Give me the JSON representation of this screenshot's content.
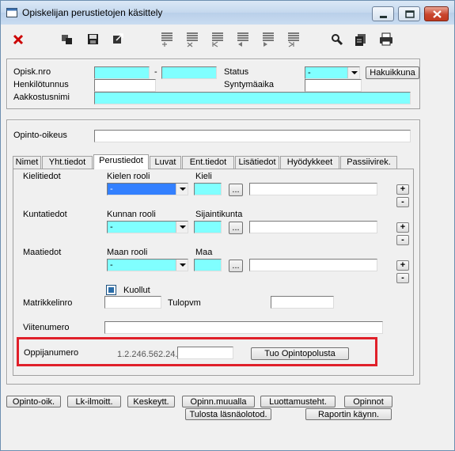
{
  "window": {
    "title": "Opiskelijan perustietojen käsittely"
  },
  "toolbar": {
    "icons": [
      "close-red-icon",
      "copy-icon",
      "save-icon",
      "export-icon",
      "insert-row-icon",
      "delete-row-icon",
      "first-record-icon",
      "previous-record-icon",
      "next-record-icon",
      "last-record-icon",
      "search-icon",
      "clipboard-icon",
      "print-icon"
    ]
  },
  "header": {
    "opisk_nro_label": "Opisk.nro",
    "dash": "-",
    "status_label": "Status",
    "status_value": "-",
    "hakuikkuna_button": "Hakuikkuna",
    "henkilotunnus_label": "Henkilötunnus",
    "syntymaaika_label": "Syntymäaika",
    "aakkostusnimi_label": "Aakkostusnimi"
  },
  "opinto_oikeus": {
    "label": "Opinto-oikeus"
  },
  "tabs": [
    {
      "label": "Nimet"
    },
    {
      "label": "Yht.tiedot"
    },
    {
      "label": "Perustiedot"
    },
    {
      "label": "Luvat"
    },
    {
      "label": "Ent.tiedot"
    },
    {
      "label": "Lisätiedot"
    },
    {
      "label": "Hyödykkeet"
    },
    {
      "label": "Passiivirek."
    }
  ],
  "perustiedot": {
    "kielitiedot_label": "Kielitiedot",
    "kielen_rooli_label": "Kielen rooli",
    "kielen_rooli_value": "-",
    "kieli_label": "Kieli",
    "kuntatiedot_label": "Kuntatiedot",
    "kunnan_rooli_label": "Kunnan rooli",
    "kunnan_rooli_value": "-",
    "sijaintikunta_label": "Sijaintikunta",
    "maatiedot_label": "Maatiedot",
    "maan_rooli_label": "Maan rooli",
    "maan_rooli_value": "-",
    "maa_label": "Maa",
    "ellipsis": "...",
    "plus": "+",
    "minus": "-",
    "kuollut_label": "Kuollut",
    "matrikkelinro_label": "Matrikkelinro",
    "tulopvm_label": "Tulopvm",
    "viitenumero_label": "Viitenumero",
    "oppijanumero_label": "Oppijanumero",
    "oppijanumero_prefix": "1.2.246.562.24.",
    "tuo_opintopolusta_button": "Tuo Opintopolusta"
  },
  "bottom_buttons": {
    "opinto_oik": "Opinto-oik.",
    "lk_ilmoitt": "Lk-ilmoitt.",
    "keskeytt": "Keskeytt.",
    "opinn_muualla": "Opinn.muualla",
    "luottamusteht": "Luottamusteht.",
    "opinnot": "Opinnot",
    "tulosta_lasnaolotod": "Tulosta läsnäolotod.",
    "raportin_kaynn": "Raportin käynn."
  },
  "colors": {
    "cyan_field": "#80ffff",
    "selected_field": "#3380ff",
    "highlight_border": "#e0202a",
    "close_icon": "#cc0000"
  }
}
